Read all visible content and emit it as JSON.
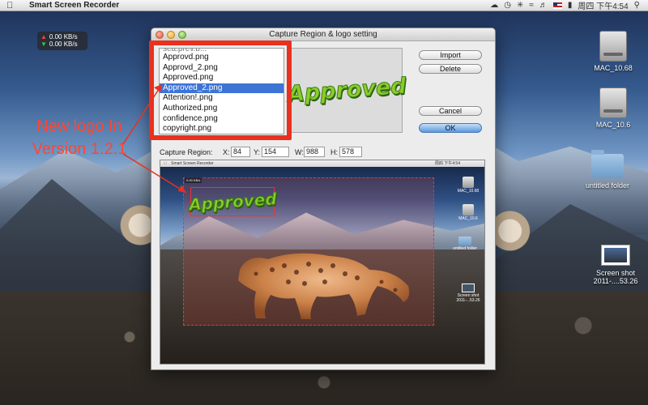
{
  "menubar": {
    "app_name": "Smart Screen Recorder",
    "clock": "周四 下午4:54",
    "status_icons": [
      "cloud-icon",
      "time-machine-icon",
      "bluetooth-icon",
      "wifi-icon",
      "volume-icon",
      "flag-icon",
      "battery-icon",
      "search-icon"
    ]
  },
  "net_widget": {
    "upload": "0.00 KB/s",
    "download": "0.00 KB/s"
  },
  "desktop_icons": [
    {
      "label": "MAC_10.68",
      "type": "hard-drive"
    },
    {
      "label": "MAC_10.6",
      "type": "hard-drive"
    },
    {
      "label": "untitled folder",
      "type": "folder"
    },
    {
      "label": "Screen shot 2011-....53.26",
      "type": "screenshot"
    }
  ],
  "annotation": {
    "text": "New logo In Version 1.2.1"
  },
  "dialog": {
    "title": "Capture Region & logo setting",
    "logo_list": {
      "partial_top": "sea.prev.b...",
      "items": [
        "Approvd.png",
        "Approvd_2.png",
        "Approved.png",
        "Approved_2.png",
        "Attention!.png",
        "Authorized.png",
        "confidence.png",
        "copyright.png"
      ],
      "selected": "Approved_2.png"
    },
    "preview_logo_text": "Approved",
    "buttons": {
      "import": "Import",
      "delete": "Delete",
      "cancel": "Cancel",
      "ok": "OK"
    },
    "capture_region": {
      "label": "Capture Region:",
      "x_label": "X:",
      "x": "84",
      "y_label": "Y:",
      "y": "154",
      "w_label": "W:",
      "w": "988",
      "h_label": "H:",
      "h": "578"
    },
    "capture_preview": {
      "menubar_app": "Smart Screen Recorder",
      "menubar_clock": "周四 下午4:54",
      "logo_text": "Approved",
      "net_text": "0.00 KB/s",
      "icons": [
        "MAC_10.68",
        "MAC_10.6",
        "untitled folder",
        "Screen shot 2011-...53.26"
      ]
    }
  },
  "colors": {
    "annotation_red": "#e8311f",
    "selection_blue": "#3d74d6",
    "logo_green": "#8ccc2c"
  }
}
